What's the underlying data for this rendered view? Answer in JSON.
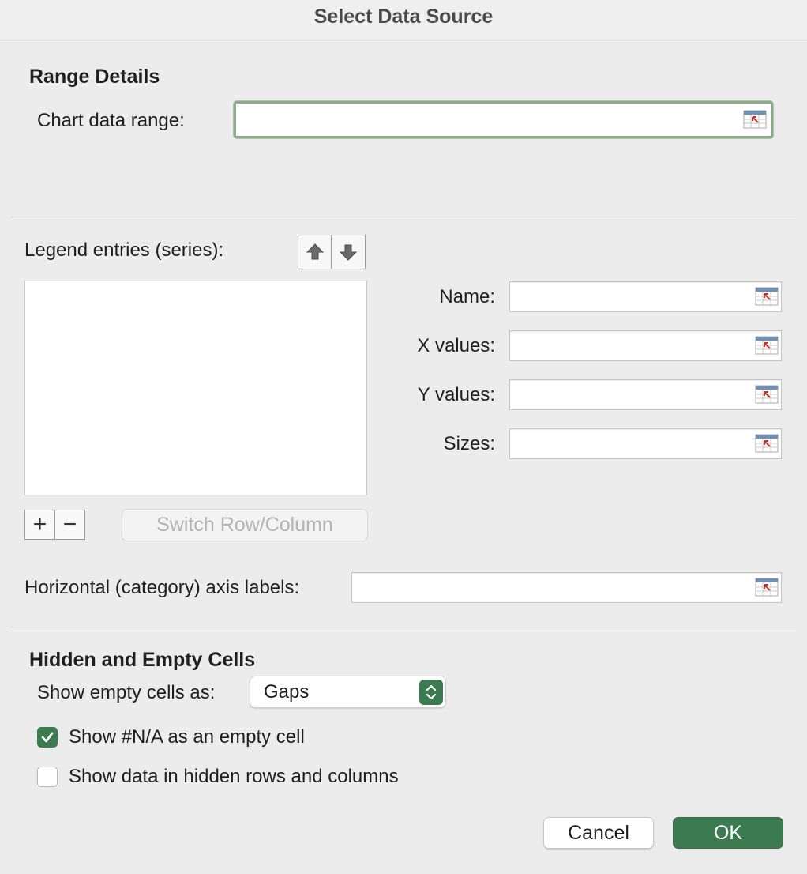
{
  "dialog": {
    "title": "Select Data Source"
  },
  "range_details": {
    "heading": "Range Details",
    "chart_data_range_label": "Chart data range:",
    "chart_data_range_value": ""
  },
  "legend": {
    "label": "Legend entries (series):",
    "series": [],
    "add_symbol": "+",
    "remove_symbol": "−",
    "switch_button_label": "Switch Row/Column",
    "move_up_icon": "arrow-up-icon",
    "move_down_icon": "arrow-down-icon"
  },
  "series_fields": {
    "name_label": "Name:",
    "name_value": "",
    "x_values_label": "X values:",
    "x_values_value": "",
    "y_values_label": "Y values:",
    "y_values_value": "",
    "sizes_label": "Sizes:",
    "sizes_value": ""
  },
  "axis": {
    "horizontal_labels_label": "Horizontal (category) axis labels:",
    "horizontal_labels_value": ""
  },
  "hidden_empty": {
    "heading": "Hidden and Empty Cells",
    "show_empty_label": "Show empty cells as:",
    "show_empty_value": "Gaps",
    "show_na_label": "Show #N/A as an empty cell",
    "show_na_checked": true,
    "show_hidden_label": "Show data in hidden rows and columns",
    "show_hidden_checked": false
  },
  "footer": {
    "cancel_label": "Cancel",
    "ok_label": "OK"
  },
  "colors": {
    "accent": "#3c7a4f",
    "focus_ring": "#8daa8d",
    "background": "#ececec"
  }
}
